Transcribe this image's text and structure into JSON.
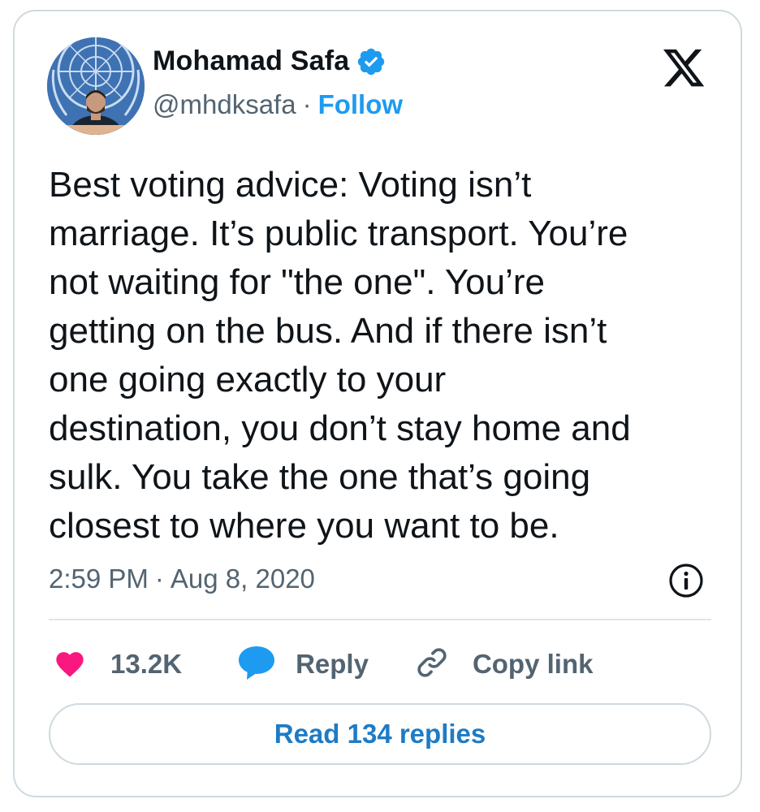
{
  "author": {
    "display_name": "Mohamad Safa",
    "handle": "@mhdksafa",
    "separator": "·",
    "follow_label": "Follow",
    "verified": true
  },
  "tweet": {
    "text": "Best voting advice: Voting isn’t\nmarriage. It’s public transport. You’re\nnot waiting for \"the one\". You’re\ngetting on the bus. And if there isn’t\none going exactly to your\ndestination, you don’t stay home and\nsulk. You take the one that’s going\nclosest to where you want to be.",
    "time": "2:59 PM",
    "separator": "·",
    "date": "Aug 8, 2020"
  },
  "actions": {
    "likes_count": "13.2K",
    "reply_label": "Reply",
    "copy_link_label": "Copy link"
  },
  "read_replies_label": "Read 134 replies",
  "icons": {
    "like": "heart-icon",
    "reply": "speech-bubble-icon",
    "copy": "link-icon",
    "info": "info-icon",
    "brand": "x-logo-icon",
    "verified": "verified-badge-icon"
  },
  "colors": {
    "accent": "#1d9bf0",
    "like": "#f91880",
    "reply": "#1d9bf0",
    "text": "#0f1419",
    "muted": "#536471",
    "border": "#cfd9de"
  }
}
